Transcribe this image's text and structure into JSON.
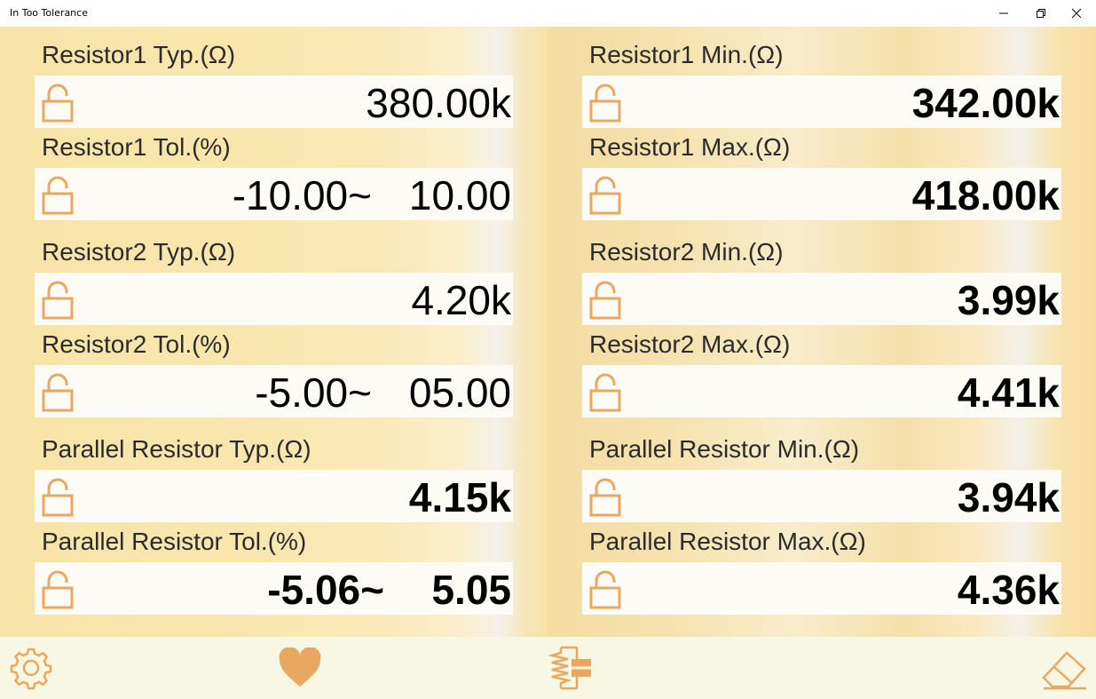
{
  "window": {
    "title": "In Too Tolerance"
  },
  "colors": {
    "accent": "#e8a860",
    "lock_stroke": "#e8a860"
  },
  "left": {
    "r1_typ": {
      "label": "Resistor1 Typ.(Ω)",
      "value": "380.00k",
      "lock_icon": "unlock-icon"
    },
    "r1_tol": {
      "label": "Resistor1 Tol.(%)",
      "min": "-10.00~",
      "max": "10.00",
      "lock_icon": "unlock-icon"
    },
    "r2_typ": {
      "label": "Resistor2 Typ.(Ω)",
      "value": "4.20k",
      "lock_icon": "unlock-icon"
    },
    "r2_tol": {
      "label": "Resistor2 Tol.(%)",
      "min": "-5.00~",
      "max": "05.00",
      "lock_icon": "unlock-icon"
    },
    "par_typ": {
      "label": "Parallel Resistor Typ.(Ω)",
      "value": "4.15k",
      "lock_icon": "unlock-icon"
    },
    "par_tol": {
      "label": "Parallel Resistor Tol.(%)",
      "min": "-5.06~",
      "max": "5.05",
      "lock_icon": "unlock-icon"
    }
  },
  "right": {
    "r1_min": {
      "label": "Resistor1 Min.(Ω)",
      "value": "342.00k",
      "lock_icon": "unlock-icon"
    },
    "r1_max": {
      "label": "Resistor1 Max.(Ω)",
      "value": "418.00k",
      "lock_icon": "unlock-icon"
    },
    "r2_min": {
      "label": "Resistor2 Min.(Ω)",
      "value": "3.99k",
      "lock_icon": "unlock-icon"
    },
    "r2_max": {
      "label": "Resistor2 Max.(Ω)",
      "value": "4.41k",
      "lock_icon": "unlock-icon"
    },
    "par_min": {
      "label": "Parallel Resistor Min.(Ω)",
      "value": "3.94k",
      "lock_icon": "unlock-icon"
    },
    "par_max": {
      "label": "Parallel Resistor Max.(Ω)",
      "value": "4.36k",
      "lock_icon": "unlock-icon"
    }
  },
  "toolbar": {
    "icons": [
      "gear-icon",
      "heart-icon",
      "parallel-resistor-icon",
      "eraser-icon"
    ]
  }
}
